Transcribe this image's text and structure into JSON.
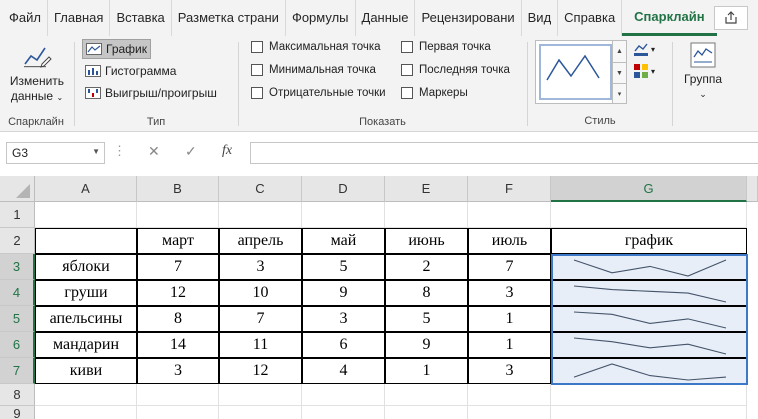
{
  "tabs": [
    "Файл",
    "Главная",
    "Вставка",
    "Разметка страни",
    "Формулы",
    "Данные",
    "Рецензировани",
    "Вид",
    "Справка",
    "Спарклайн"
  ],
  "ribbon": {
    "edit_data_line1": "Изменить",
    "edit_data_line2": "данные",
    "group_sparkline": "Спарклайн",
    "type_line": "График",
    "type_column": "Гистограмма",
    "type_winloss": "Выигрыш/проигрыш",
    "group_type": "Тип",
    "show_high": "Максимальная точка",
    "show_low": "Минимальная точка",
    "show_negative": "Отрицательные точки",
    "show_first": "Первая точка",
    "show_last": "Последняя точка",
    "show_markers": "Маркеры",
    "group_show": "Показать",
    "group_style": "Стиль",
    "group_btn": "Группа"
  },
  "formula_bar": {
    "name_box": "G3",
    "fx": "fx",
    "formula": ""
  },
  "sheet": {
    "columns": [
      "A",
      "B",
      "C",
      "D",
      "E",
      "F",
      "G"
    ],
    "rows": [
      "1",
      "2",
      "3",
      "4",
      "5",
      "6",
      "7",
      "8",
      "9"
    ],
    "header": [
      "",
      "март",
      "апрель",
      "май",
      "июнь",
      "июль",
      "график"
    ],
    "data": [
      {
        "name": "яблоки",
        "values": [
          7,
          3,
          5,
          2,
          7
        ]
      },
      {
        "name": "груши",
        "values": [
          12,
          10,
          9,
          8,
          3
        ]
      },
      {
        "name": "апельсины",
        "values": [
          8,
          7,
          3,
          5,
          1
        ]
      },
      {
        "name": "мандарин",
        "values": [
          14,
          11,
          6,
          9,
          1
        ]
      },
      {
        "name": "киви",
        "values": [
          3,
          12,
          4,
          1,
          3
        ]
      }
    ],
    "sparkline_color": "#44546a",
    "selection_color": "#3d78c8",
    "accent": "#217346"
  }
}
